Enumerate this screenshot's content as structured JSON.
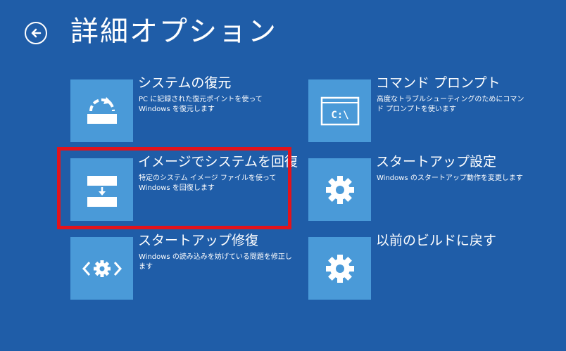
{
  "header": {
    "back_icon": "back-arrow-circle-icon",
    "title": "詳細オプション"
  },
  "options": [
    {
      "title": "システムの復元",
      "description": "PC に記録された復元ポイントを使って Windows を復元します",
      "icon": "system-restore-icon"
    },
    {
      "title": "コマンド プロンプト",
      "description": "高度なトラブルシューティングのためにコマンド プロンプトを使います",
      "icon": "command-prompt-icon",
      "icon_text": "C:\\"
    },
    {
      "title": "イメージでシステムを回復",
      "description": "特定のシステム イメージ ファイルを使って Windows を回復します",
      "icon": "system-image-recovery-icon"
    },
    {
      "title": "スタートアップ設定",
      "description": "Windows のスタートアップ動作を変更します",
      "icon": "gear-icon"
    },
    {
      "title": "スタートアップ修復",
      "description": "Windows の読み込みを妨げている問題を修正します",
      "icon": "startup-repair-icon"
    },
    {
      "title": "以前のビルドに戻す",
      "description": "",
      "icon": "gear-icon"
    }
  ],
  "colors": {
    "background": "#1f5da8",
    "tile": "#4a9ad8",
    "highlight_border": "#e3131b",
    "text": "#ffffff"
  }
}
